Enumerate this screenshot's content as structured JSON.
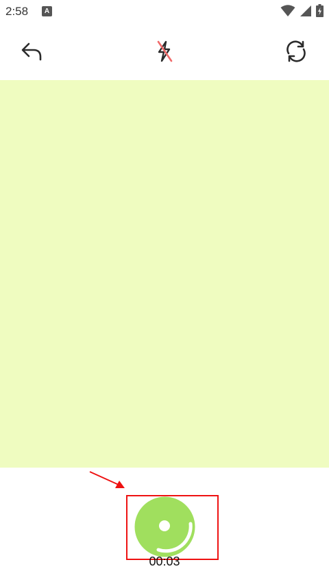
{
  "status_bar": {
    "time": "2:58",
    "notification_badge": "A",
    "icons": [
      "wifi-icon",
      "signal-icon",
      "battery-charging-icon"
    ]
  },
  "toolbar": {
    "back_icon": "undo-arrow-icon",
    "flash_icon": "flash-off-icon",
    "switch_camera_icon": "camera-switch-icon"
  },
  "preview": {
    "color": "#effcc0"
  },
  "recorder": {
    "timer": "00:03",
    "button_color": "#a0df5e",
    "annotation_color": "#ee1111"
  }
}
